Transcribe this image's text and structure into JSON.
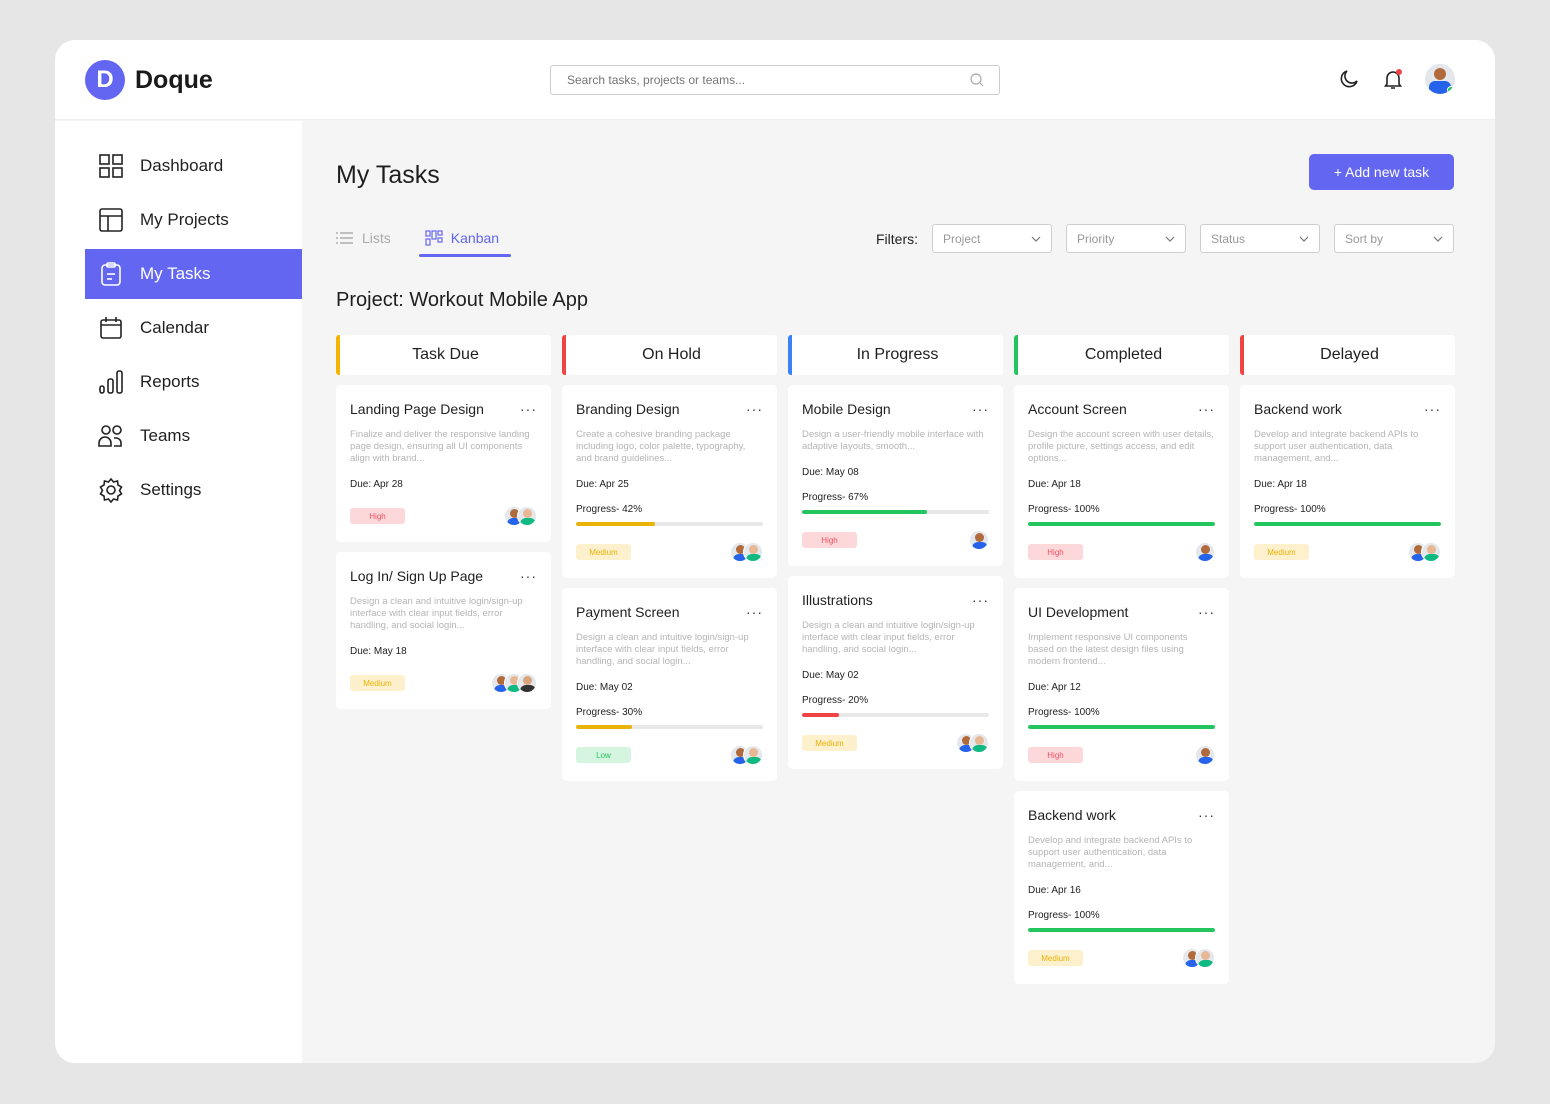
{
  "app": {
    "name": "Doque",
    "logo_letter": "D"
  },
  "search": {
    "placeholder": "Search tasks, projects or teams..."
  },
  "sidebar": {
    "items": [
      {
        "label": "Dashboard",
        "icon": "grid-icon"
      },
      {
        "label": "My Projects",
        "icon": "layout-icon"
      },
      {
        "label": "My Tasks",
        "icon": "clipboard-icon",
        "active": true
      },
      {
        "label": "Calendar",
        "icon": "calendar-icon"
      },
      {
        "label": "Reports",
        "icon": "bar-chart-icon"
      },
      {
        "label": "Teams",
        "icon": "users-icon"
      },
      {
        "label": "Settings",
        "icon": "gear-icon"
      }
    ]
  },
  "main": {
    "title": "My Tasks",
    "add_label": "+ Add new task",
    "tabs": [
      {
        "label": "Lists"
      },
      {
        "label": "Kanban",
        "active": true
      }
    ],
    "filters_label": "Filters:",
    "filters": [
      "Project",
      "Priority",
      "Status",
      "Sort by"
    ],
    "project_title": "Project: Workout Mobile App"
  },
  "colors": {
    "accent": "#6366f1",
    "high_bg": "#fdd8db",
    "high_fg": "#f05260",
    "medium_bg": "#fdf0cc",
    "medium_fg": "#eab308",
    "low_bg": "#d6f5e0",
    "low_fg": "#22c55e"
  },
  "columns": [
    {
      "name": "Task Due",
      "color": "#f5b400",
      "cards": [
        {
          "title": "Landing Page Design",
          "desc": "Finalize and deliver the responsive landing page design, ensuring all UI components align with brand...",
          "due": "Due: Apr 28",
          "priority": "High",
          "avatars": 2
        },
        {
          "title": "Log In/ Sign Up Page",
          "desc": "Design a clean and intuitive login/sign-up interface with clear input fields, error handling, and social login...",
          "due": "Due: May 18",
          "priority": "Medium",
          "avatars": 3
        }
      ]
    },
    {
      "name": "On Hold",
      "color": "#ef4444",
      "cards": [
        {
          "title": "Branding Design",
          "desc": "Create a cohesive branding package including logo, color palette, typography, and brand guidelines...",
          "due": "Due: Apr 25",
          "progress_label": "Progress-  42%",
          "progress": 42,
          "bar_color": "#eab308",
          "priority": "Medium",
          "avatars": 2
        },
        {
          "title": "Payment Screen",
          "desc": "Design a clean and intuitive login/sign-up interface with clear input fields, error handling, and social login...",
          "due": "Due: May 02",
          "progress_label": "Progress-  30%",
          "progress": 30,
          "bar_color": "#eab308",
          "priority": "Low",
          "avatars": 2
        }
      ]
    },
    {
      "name": "In Progress",
      "color": "#3b82f6",
      "cards": [
        {
          "title": "Mobile Design",
          "desc": "Design a user-friendly mobile interface with adaptive layouts, smooth...",
          "due": "Due: May 08",
          "progress_label": "Progress-  67%",
          "progress": 67,
          "bar_color": "#22c55e",
          "priority": "High",
          "avatars": 1
        },
        {
          "title": "Illustrations",
          "desc": "Design a clean and intuitive login/sign-up interface with clear input fields, error handling, and social login...",
          "due": "Due: May 02",
          "progress_label": "Progress-  20%",
          "progress": 20,
          "bar_color": "#ef4444",
          "priority": "Medium",
          "avatars": 2
        }
      ]
    },
    {
      "name": "Completed",
      "color": "#22c55e",
      "cards": [
        {
          "title": "Account Screen",
          "desc": "Design the account screen with user details, profile picture, settings access, and edit options...",
          "due": "Due: Apr 18",
          "progress_label": "Progress-  100%",
          "progress": 100,
          "bar_color": "#22c55e",
          "priority": "High",
          "avatars": 1
        },
        {
          "title": "UI Development",
          "desc": "Implement responsive UI components based on the latest design files using modern frontend...",
          "due": "Due: Apr 12",
          "progress_label": "Progress-  100%",
          "progress": 100,
          "bar_color": "#22c55e",
          "priority": "High",
          "avatars": 1
        },
        {
          "title": "Backend work",
          "desc": "Develop and integrate backend APIs to support user authentication, data management, and...",
          "due": "Due: Apr 16",
          "progress_label": "Progress-  100%",
          "progress": 100,
          "bar_color": "#22c55e",
          "priority": "Medium",
          "avatars": 2
        }
      ]
    },
    {
      "name": "Delayed",
      "color": "#ef4444",
      "cards": [
        {
          "title": "Backend work",
          "desc": "Develop and integrate backend APIs to support user authentication, data management, and...",
          "due": "Due: Apr 18",
          "progress_label": "Progress-  100%",
          "progress": 100,
          "bar_color": "#22c55e",
          "priority": "Medium",
          "avatars": 2
        }
      ]
    }
  ]
}
